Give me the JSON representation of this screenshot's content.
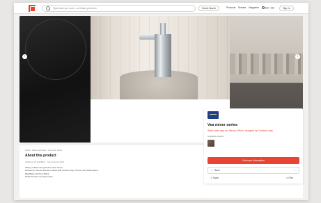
{
  "header": {
    "search_placeholder": "Type what you need – we'll take you there",
    "smart_search": "Smart Search",
    "nav": [
      "Products",
      "Brands",
      "Magazine"
    ],
    "language": "EN - GB",
    "sign_in": "Sign In"
  },
  "hero": {
    "prev_arrow": "‹",
    "next_arrow": "›"
  },
  "product": {
    "title": "Vea mixer series",
    "subtitle": "Wash basin taps by Villeroy & Boch, designed by Christian Haas",
    "finishes_label": "Available variants",
    "cta": "Get more information",
    "save": "Save",
    "share": "Share",
    "print": "Print"
  },
  "about": {
    "breadcrumb": "Home / Wash basin taps / Vea mixer series",
    "title": "About this product",
    "meta": "Architonic ID 20188941 · Year of launch 2023",
    "lines": [
      "Villeroy & Boch Vea premium mixer series",
      "Finishes in Chrome and as a variant with ceramic inlay: Chrome with White Alpine,",
      "Matt Black with Pure Black",
      "Tactile function via finger touch"
    ]
  },
  "colors": {
    "accent": "#e94433",
    "brand_blue": "#1f3e8c"
  }
}
